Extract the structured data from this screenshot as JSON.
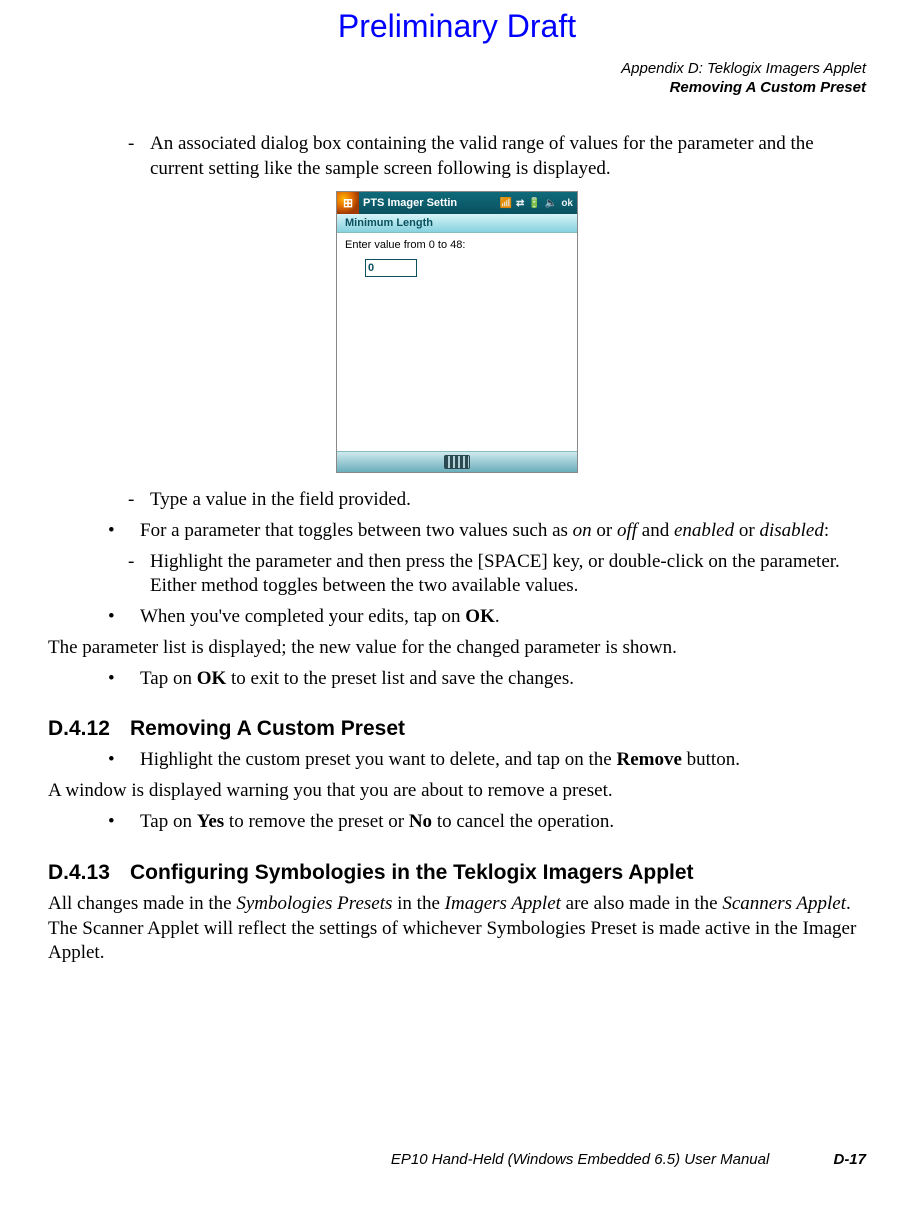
{
  "watermark": "Preliminary Draft",
  "header": {
    "line1": "Appendix D:  Teklogix Imagers Applet",
    "line2": "Removing A Custom Preset"
  },
  "intro_dash": "An associated dialog box containing the valid range of values for the parameter and the current setting like the sample screen following is displayed.",
  "phone": {
    "title": "PTS Imager Settin",
    "ok": "ok",
    "subbar": "Minimum Length",
    "prompt": "Enter value from 0 to 48:",
    "value": "0"
  },
  "after_img": {
    "dash1": "Type a value in the field provided.",
    "bullet1_pre": "For a parameter that toggles between two values such as ",
    "on": "on",
    "or1": " or ",
    "off": "off",
    "and": " and ",
    "enabled": "enabled",
    "or2": " or ",
    "disabled": "disabled",
    "colon": ":",
    "dash2": "Highlight the parameter and then press the [SPACE] key, or double-click on the parameter. Either method toggles between the two available values.",
    "bullet2_pre": "When you've completed your edits, tap on ",
    "ok_b": "OK",
    "bullet2_post": ".",
    "para": "The parameter list is displayed; the new value for the changed parameter is shown.",
    "bullet3_pre": "Tap on ",
    "bullet3_post": " to exit to the preset list and save the changes."
  },
  "sec12": {
    "num": "D.4.12",
    "title": "Removing A Custom Preset",
    "b1_pre": "Highlight the custom preset you want to delete, and tap on the ",
    "remove": "Remove",
    "b1_post": " button.",
    "para": "A window is displayed warning you that you are about to remove a preset.",
    "b2_pre": "Tap on ",
    "yes": "Yes",
    "mid": " to remove the preset or ",
    "no": "No",
    "b2_post": " to cancel the operation."
  },
  "sec13": {
    "num": "D.4.13",
    "title": "Configuring Symbologies in the Teklogix Imagers Applet",
    "p_pre": "All changes made in the ",
    "sym": "Symbologies Presets",
    "mid1": " in the ",
    "ia": "Imagers Applet",
    "mid2": " are also made in the ",
    "sa": "Scanners Applet",
    "p_post": ". The Scanner Applet will reflect the settings of whichever Symbologies Preset is made active in the Imager Applet."
  },
  "footer": {
    "title": "EP10 Hand-Held (Windows Embedded 6.5) User Manual",
    "page": "D-17"
  }
}
